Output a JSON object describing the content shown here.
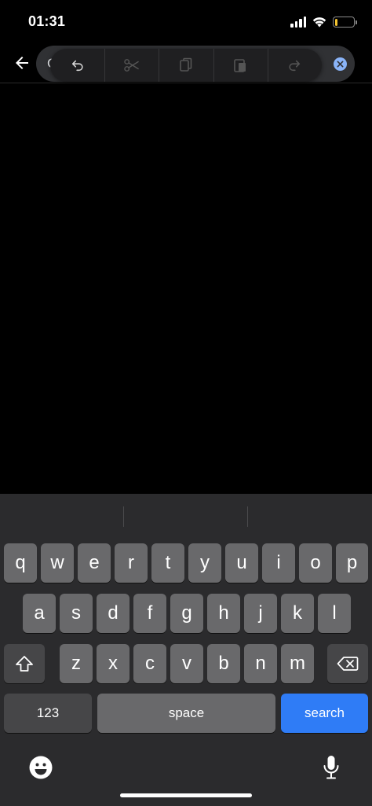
{
  "status_bar": {
    "time": "01:31",
    "battery_level": 0.15
  },
  "search": {
    "value": "C",
    "placeholder": ""
  },
  "edit_menu": {
    "items": [
      "undo-icon",
      "scissors-icon",
      "copy-icon",
      "paste-icon",
      "redo-icon"
    ]
  },
  "keyboard": {
    "row1": [
      "q",
      "w",
      "e",
      "r",
      "t",
      "y",
      "u",
      "i",
      "o",
      "p"
    ],
    "row2": [
      "a",
      "s",
      "d",
      "f",
      "g",
      "h",
      "j",
      "k",
      "l"
    ],
    "row3": [
      "z",
      "x",
      "c",
      "v",
      "b",
      "n",
      "m"
    ],
    "numbers_label": "123",
    "space_label": "space",
    "search_label": "search"
  },
  "colors": {
    "accent": "#2f7cf6",
    "clear_button": "#8ab4f8",
    "battery": "#f4c430"
  }
}
